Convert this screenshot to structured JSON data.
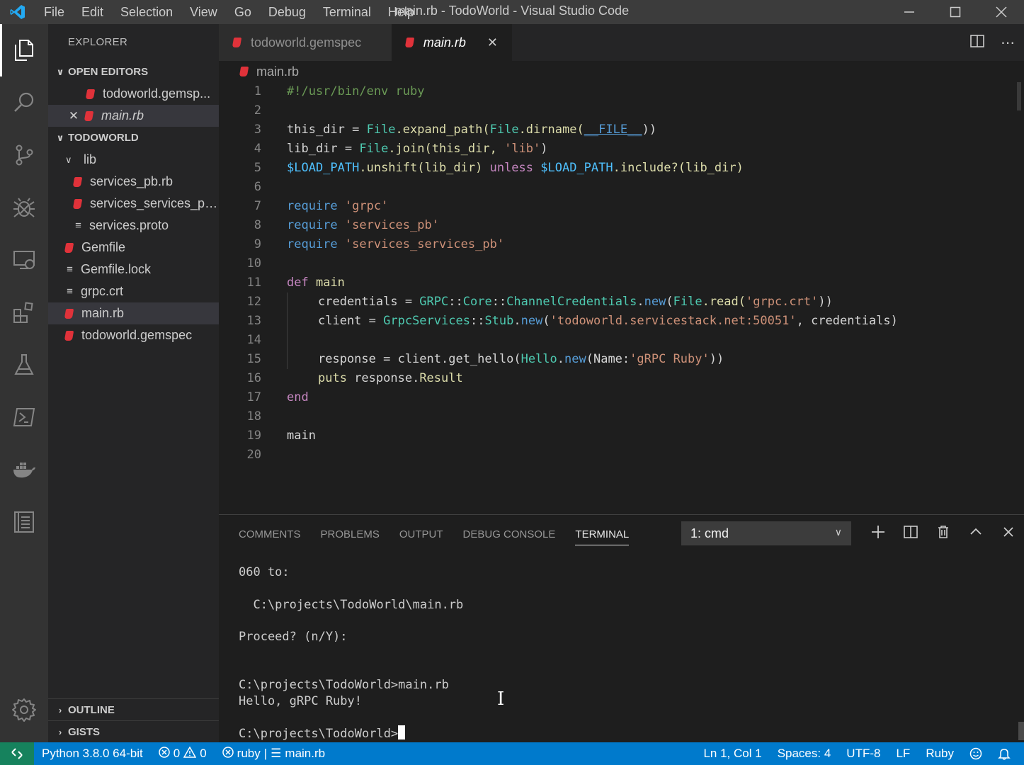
{
  "app": {
    "window_title": "main.rb - TodoWorld - Visual Studio Code",
    "menu": [
      "File",
      "Edit",
      "Selection",
      "View",
      "Go",
      "Debug",
      "Terminal",
      "Help"
    ]
  },
  "sidebar": {
    "header": "EXPLORER",
    "open_editors_label": "OPEN EDITORS",
    "open_editors": [
      {
        "label": "todoworld.gemsp..."
      },
      {
        "label": "main.rb"
      }
    ],
    "project_label": "TODOWORLD",
    "tree": [
      {
        "label": "lib"
      },
      {
        "label": "services_pb.rb"
      },
      {
        "label": "services_services_pb...."
      },
      {
        "label": "services.proto"
      },
      {
        "label": "Gemfile"
      },
      {
        "label": "Gemfile.lock"
      },
      {
        "label": "grpc.crt"
      },
      {
        "label": "main.rb"
      },
      {
        "label": "todoworld.gemspec"
      }
    ],
    "outline_label": "OUTLINE",
    "gists_label": "GISTS"
  },
  "tabs": [
    {
      "label": "todoworld.gemspec"
    },
    {
      "label": "main.rb"
    }
  ],
  "breadcrumb": "main.rb",
  "editor": {
    "line_numbers": [
      "1",
      "2",
      "3",
      "4",
      "5",
      "6",
      "7",
      "8",
      "9",
      "10",
      "11",
      "12",
      "13",
      "14",
      "15",
      "16",
      "17",
      "18",
      "19",
      "20"
    ],
    "tokens": {
      "l1": "#!/usr/bin/env ruby",
      "l3a": "this_dir = ",
      "l3b": "File",
      "l3c": ".expand_path(",
      "l3d": "File",
      "l3e": ".dirname(",
      "l3f": "__FILE__",
      "l3g": "))",
      "l4a": "lib_dir = ",
      "l4b": "File",
      "l4c": ".join(this_dir, ",
      "l4d": "'lib'",
      "l4e": ")",
      "l5a": "$LOAD_PATH",
      "l5b": ".unshift(lib_dir) ",
      "l5c": "unless",
      "l5d": " ",
      "l5e": "$LOAD_PATH",
      "l5f": ".include?(lib_dir)",
      "l7a": "require",
      "l7b": " ",
      "l7c": "'grpc'",
      "l8a": "require",
      "l8b": " ",
      "l8c": "'services_pb'",
      "l9a": "require",
      "l9b": " ",
      "l9c": "'services_services_pb'",
      "l11a": "def",
      "l11b": " ",
      "l11c": "main",
      "l12a": "credentials = ",
      "l12b": "GRPC",
      "l12c": "::",
      "l12d": "Core",
      "l12e": "::",
      "l12f": "ChannelCredentials",
      "l12g": ".",
      "l12h": "new",
      "l12i": "(",
      "l12j": "File",
      "l12k": ".read(",
      "l12l": "'grpc.crt'",
      "l12m": "))",
      "l13a": "client = ",
      "l13b": "GrpcServices",
      "l13c": "::",
      "l13d": "Stub",
      "l13e": ".",
      "l13f": "new",
      "l13g": "(",
      "l13h": "'todoworld.servicestack.net:50051'",
      "l13i": ", credentials)",
      "l15a": "response = client.get_hello(",
      "l15b": "Hello",
      "l15c": ".",
      "l15d": "new",
      "l15e": "(Name:",
      "l15f": "'gRPC Ruby'",
      "l15g": "))",
      "l16a": "puts",
      "l16b": " response.",
      "l16c": "Result",
      "l17a": "end",
      "l19a": "main"
    }
  },
  "panel": {
    "tabs": [
      "COMMENTS",
      "PROBLEMS",
      "OUTPUT",
      "DEBUG CONSOLE",
      "TERMINAL"
    ],
    "terminal_select": "1: cmd",
    "terminal_lines": [
      "060 to:",
      "  C:\\projects\\TodoWorld\\main.rb",
      "Proceed? (n/Y):",
      "C:\\projects\\TodoWorld>main.rb",
      "Hello, gRPC Ruby!",
      "C:\\projects\\TodoWorld>"
    ]
  },
  "status": {
    "python": "Python 3.8.0 64-bit",
    "errors": "0",
    "warnings": "0",
    "ruby_lint": "ruby",
    "file": "main.rb",
    "position": "Ln 1, Col 1",
    "spaces": "Spaces: 4",
    "encoding": "UTF-8",
    "eol": "LF",
    "language": "Ruby"
  },
  "colors": {
    "accent": "#007acc",
    "ruby_icon": "#e0323a",
    "remote": "#16825d"
  }
}
